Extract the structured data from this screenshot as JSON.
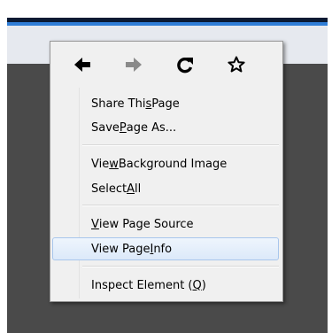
{
  "context_menu": {
    "nav": [
      {
        "name": "back",
        "icon": "back-arrow-icon",
        "enabled": true
      },
      {
        "name": "forward",
        "icon": "forward-arrow-icon",
        "enabled": false
      },
      {
        "name": "reload",
        "icon": "reload-icon",
        "enabled": true
      },
      {
        "name": "bookmark",
        "icon": "star-outline-icon",
        "enabled": true
      }
    ],
    "items": {
      "share_page": {
        "before": "Share Thi",
        "accel": "s",
        "after": " Page"
      },
      "save_page_as": {
        "before": "Save ",
        "accel": "P",
        "after": "age As..."
      },
      "view_background_image": {
        "before": "Vie",
        "accel": "w",
        "after": " Background Image"
      },
      "select_all": {
        "before": "Select ",
        "accel": "A",
        "after": "ll"
      },
      "view_page_source": {
        "before": "",
        "accel": "V",
        "after": "iew Page Source"
      },
      "view_page_info": {
        "before": "View Page ",
        "accel": "I",
        "after": "nfo"
      },
      "inspect_element": {
        "before": "Inspect Element (",
        "accel": "Q",
        "after": ")"
      }
    },
    "highlighted_item": "view_page_info"
  },
  "colors": {
    "window_title_bar": "#0b1a33",
    "accent_blue": "#2f7dd6",
    "page_background": "#4a4a4a",
    "menu_background": "#f0f0f0",
    "highlight_border": "#a8c6ec",
    "disabled_icon": "#8a8a8a"
  }
}
